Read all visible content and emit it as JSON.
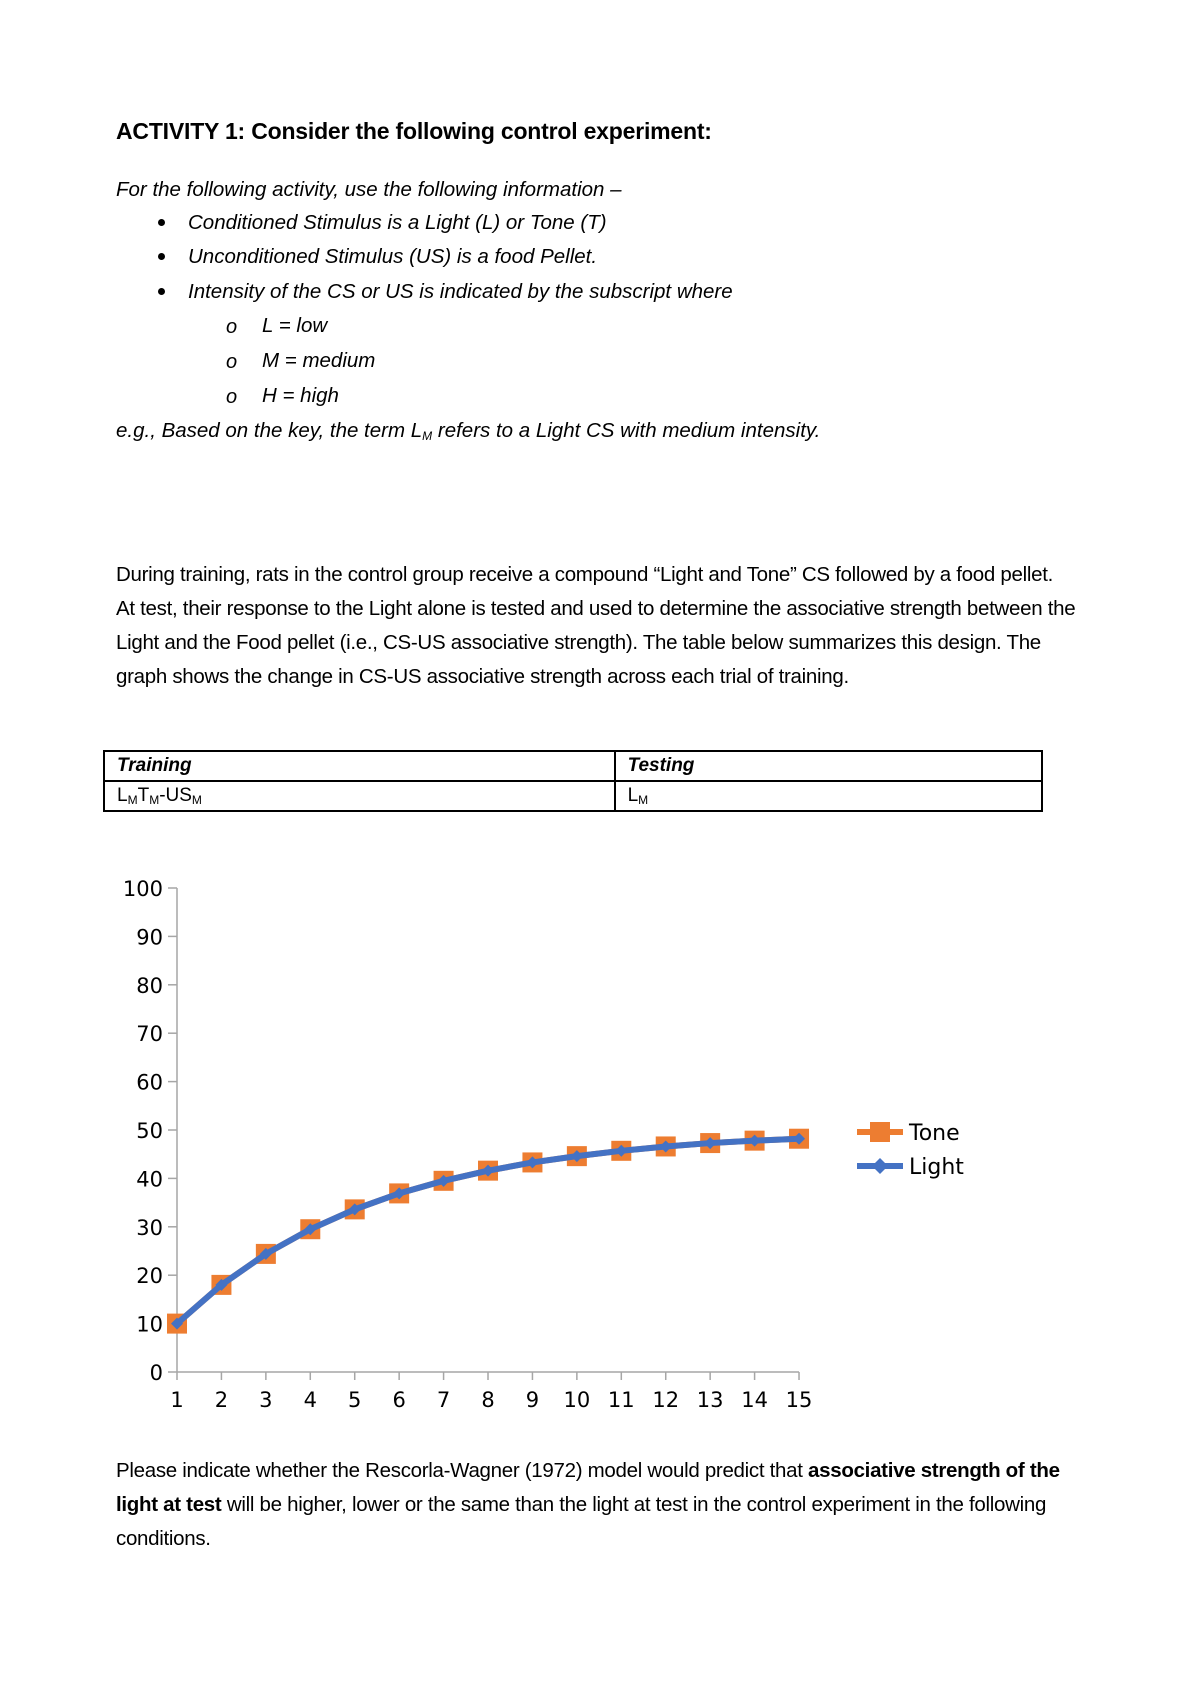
{
  "heading": "ACTIVITY 1: Consider the following control experiment:",
  "intro": "For the following activity, use the following information –",
  "bullets": [
    "Conditioned Stimulus is a Light (L) or Tone (T)",
    "Unconditioned Stimulus (US) is a food Pellet.",
    "Intensity of the CS or US is indicated by the subscript where"
  ],
  "sub_bullets": [
    "L = low",
    "M = medium",
    "H = high"
  ],
  "sub_bullet_marker": "o",
  "example": {
    "before": "e.g., Based on the key, the term L",
    "subscript": "M",
    "after": " refers to a Light CS with medium intensity."
  },
  "paragraph": "During training, rats in the control group receive a compound “Light and Tone” CS followed by a food pellet. At test, their response to the Light alone is tested and used to determine the associative strength between the Light and the Food pellet (i.e., CS-US associative strength). The table below summarizes this design. The graph shows the change in CS-US associative strength across each trial of training.",
  "table": {
    "headers": [
      "Training",
      "Testing"
    ],
    "row": {
      "training": [
        {
          "t": "L",
          "s": "M"
        },
        {
          "t": "T",
          "s": "M"
        },
        {
          "t": "-US",
          "s": "M"
        }
      ],
      "testing": [
        {
          "t": "L",
          "s": "M"
        }
      ]
    }
  },
  "question": {
    "part1": "Please indicate whether the Rescorla-Wagner (1972) model would predict that ",
    "bold": "associative strength of the light at test",
    "part2": " will be higher, lower or the same than the light at test in the control experiment in the following conditions."
  },
  "chart_data": {
    "type": "line",
    "title": "",
    "xlabel": "",
    "ylabel": "",
    "x": [
      1,
      2,
      3,
      4,
      5,
      6,
      7,
      8,
      9,
      10,
      11,
      12,
      13,
      14,
      15
    ],
    "ylim": [
      0,
      100
    ],
    "yticks": [
      0,
      10,
      20,
      30,
      40,
      50,
      60,
      70,
      80,
      90,
      100
    ],
    "grid": false,
    "legend_position": "right",
    "series": [
      {
        "name": "Tone",
        "color": "#ED7D31",
        "marker": "square",
        "values": [
          10,
          18,
          24.4,
          29.5,
          33.6,
          36.9,
          39.5,
          41.6,
          43.3,
          44.6,
          45.7,
          46.6,
          47.3,
          47.8,
          48.2
        ]
      },
      {
        "name": "Light",
        "color": "#4472C4",
        "marker": "diamond",
        "values": [
          10,
          18,
          24.4,
          29.5,
          33.6,
          36.9,
          39.5,
          41.6,
          43.3,
          44.6,
          45.7,
          46.6,
          47.3,
          47.8,
          48.2
        ]
      }
    ]
  }
}
